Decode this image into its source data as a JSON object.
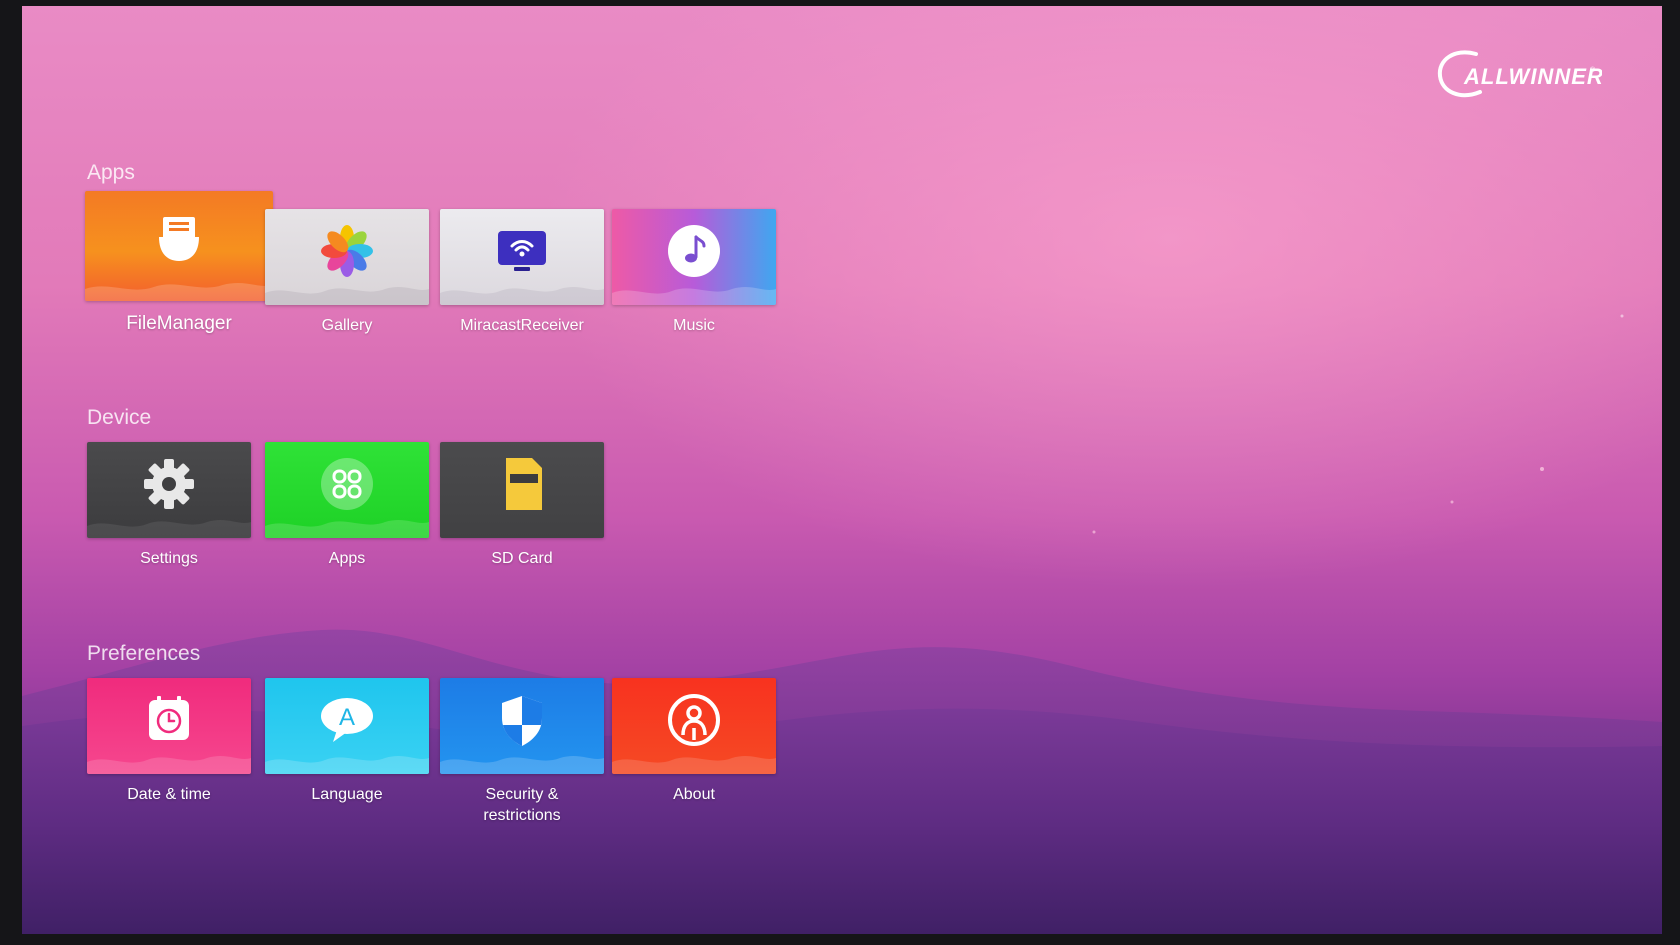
{
  "brand": {
    "logo_text": "ALLWINNER"
  },
  "sections": {
    "apps": {
      "title": "Apps",
      "items": [
        {
          "label": "FileManager",
          "icon": "file-manager-icon"
        },
        {
          "label": "Gallery",
          "icon": "gallery-pinwheel-icon"
        },
        {
          "label": "MiracastReceiver",
          "icon": "miracast-wifi-display-icon"
        },
        {
          "label": "Music",
          "icon": "music-note-icon"
        }
      ]
    },
    "device": {
      "title": "Device",
      "items": [
        {
          "label": "Settings",
          "icon": "gear-icon"
        },
        {
          "label": "Apps",
          "icon": "apps-grid-icon"
        },
        {
          "label": "SD Card",
          "icon": "sd-card-icon"
        }
      ]
    },
    "preferences": {
      "title": "Preferences",
      "items": [
        {
          "label": "Date & time",
          "icon": "clock-icon"
        },
        {
          "label": "Language",
          "icon": "language-bubble-icon"
        },
        {
          "label": "Security & restrictions",
          "icon": "shield-icon"
        },
        {
          "label": "About",
          "icon": "about-person-icon"
        }
      ]
    }
  },
  "focused_item": "FileManager"
}
